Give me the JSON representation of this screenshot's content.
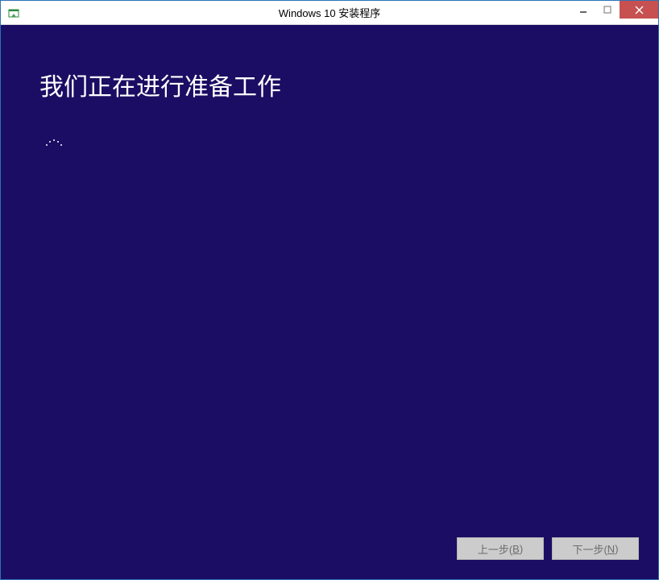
{
  "window": {
    "title": "Windows 10 安装程序"
  },
  "content": {
    "heading": "我们正在进行准备工作"
  },
  "footer": {
    "back_label_prefix": "上一步(",
    "back_mnemonic": "B",
    "back_label_suffix": ")",
    "next_label_prefix": "下一步(",
    "next_mnemonic": "N",
    "next_label_suffix": ")"
  }
}
